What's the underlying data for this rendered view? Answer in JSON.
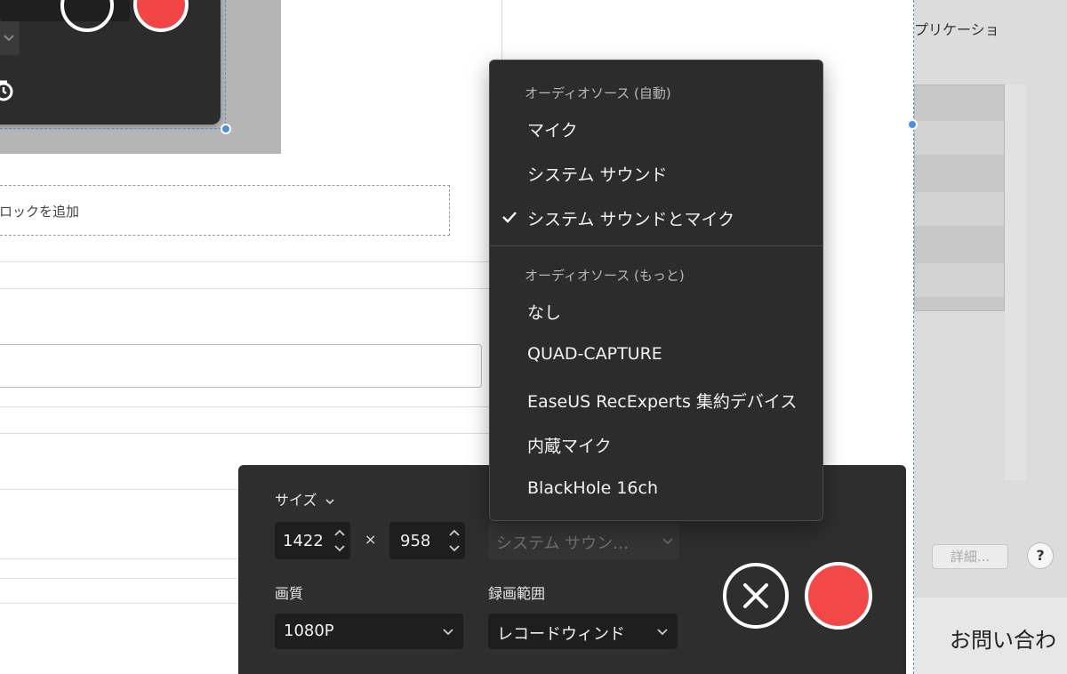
{
  "background": {
    "add_block_label": "ロックを追加",
    "right_panel_title": "プリケーショ",
    "details_button": "詳細...",
    "help_button": "?",
    "contact_text": "お問い合わ"
  },
  "panel": {
    "size_label": "サイズ",
    "width_value": "1422",
    "times_symbol": "×",
    "height_value": "958",
    "audio_selected": "システム サウン…",
    "quality_label": "画質",
    "quality_value": "1080P",
    "range_label": "録画範囲",
    "range_value": "レコードウィンド"
  },
  "audio_menu": {
    "auto_header": "オーディオソース (自動)",
    "auto_items": [
      {
        "label": "マイク",
        "checked": false
      },
      {
        "label": "システム サウンド",
        "checked": false
      },
      {
        "label": "システム サウンドとマイク",
        "checked": true
      }
    ],
    "more_header": "オーディオソース (もっと)",
    "more_items": [
      {
        "label": "なし"
      },
      {
        "label": "QUAD-CAPTURE"
      },
      {
        "label": "EaseUS RecExperts 集約デバイス"
      },
      {
        "label": "内蔵マイク"
      },
      {
        "label": "BlackHole 16ch"
      }
    ]
  },
  "colors": {
    "record_red": "#f24848",
    "panel_bg": "#2e2e2e",
    "selection_blue": "#4a90e2"
  }
}
